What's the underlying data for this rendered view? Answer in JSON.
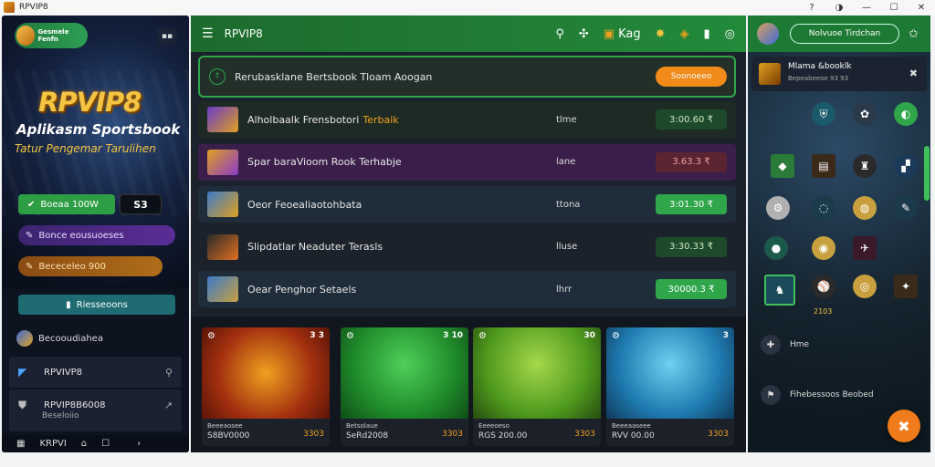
{
  "window": {
    "title": "RPVIP8",
    "controls": [
      "?",
      "◑",
      "—",
      "☐",
      "✕"
    ]
  },
  "sidebar": {
    "logo_text": "Gesmele Fenfn",
    "brand": "RPVIP8",
    "tagline1": "Aplikasm Sportsbook",
    "tagline2": "Tatur Pengemar Tarulihen",
    "login_button": "Boeaa 100W",
    "dark_button": "S3",
    "purple_pill": "Bonce eousuoeses",
    "orange_pill": "Bececeleo 900",
    "teal_button": "Riesseoons",
    "section_title": "Becooudiahea",
    "items": [
      {
        "label": "RPVIVP8",
        "sub": ""
      },
      {
        "label": "RPVIP8B6008",
        "sub": "Beseloiio"
      }
    ],
    "bottom_nav": {
      "label": "KRPVI",
      "icons": [
        "home-icon",
        "chat-icon",
        "arrow-icon"
      ]
    }
  },
  "topbar": {
    "title": "RPVIP8",
    "label": "Kag"
  },
  "search": {
    "text": "Rerubasklane Bertsbook Tloam Aoogan",
    "button": "Soonoeeo"
  },
  "rows": [
    {
      "title": "Alholbaalk Frensbotori",
      "highlight": "Terbaik",
      "mid": "tlme",
      "value": "3:00.60 ₹",
      "bg": "#1e2a24",
      "valbg": "#1c4a2a",
      "valfg": "#cfe8c0"
    },
    {
      "title": "Spar baraVioom Rook Terhabje",
      "highlight": "",
      "mid": "lane",
      "value": "3.63.3 ₹",
      "bg": "#3a1f4a",
      "valbg": "#5a2530",
      "valfg": "#f0a0a0"
    },
    {
      "title": "Oeor Feoealiaotohbata",
      "highlight": "",
      "mid": "ttona",
      "value": "3:01.30 ₹",
      "bg": "#1f2d3a",
      "valbg": "#2fa64a",
      "valfg": "#ffffff"
    },
    {
      "title": "Slipdatlar Neaduter Terasls",
      "highlight": "",
      "mid": "lluse",
      "value": "3:30.33 ₹",
      "bg": "#1c222b",
      "valbg": "#1c4a2a",
      "valfg": "#cfe8c0"
    },
    {
      "title": "Oear Penghor Setaels",
      "highlight": "",
      "mid": "lhrr",
      "value": "30000.3 ₹",
      "bg": "#1f2d3a",
      "valbg": "#2fa64a",
      "valfg": "#ffffff"
    }
  ],
  "cards": [
    {
      "corner": "3 3",
      "cap": "Beeeaosee",
      "cap2": "S8BV0000",
      "amt": "3303"
    },
    {
      "corner": "3 10",
      "cap": "Betsolaue",
      "cap2": "SeRd2008",
      "amt": "3303"
    },
    {
      "corner": "30",
      "cap": "Eeeeoeso",
      "cap2": "RGS 200.00",
      "amt": "3303"
    },
    {
      "corner": "3",
      "cap": "Beeeaaseee",
      "cap2": "RVV 00.00",
      "amt": "3303"
    }
  ],
  "right_panel": {
    "user": "Nolvuoe Tirdchan",
    "card_title": "Mlama &booklk",
    "card_sub": "Bepeabeeoe 93 93",
    "year_label": "2103",
    "list": [
      {
        "label": "Hme"
      },
      {
        "label": "Fihebessoos Beobed"
      }
    ]
  },
  "colors": {
    "green": "#238a3a",
    "orange": "#f08a19",
    "gold": "#f4c443"
  }
}
